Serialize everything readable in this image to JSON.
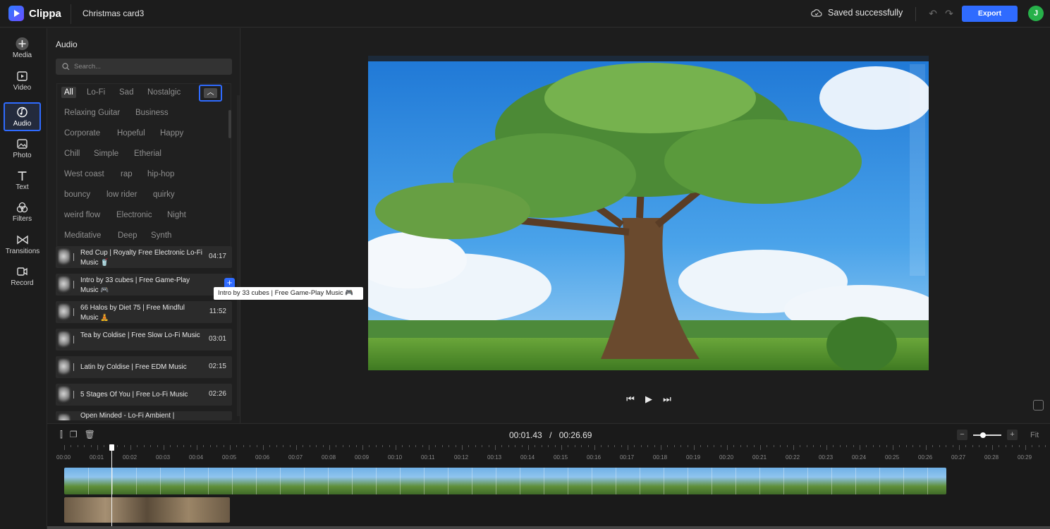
{
  "header": {
    "app_name": "Clippa",
    "project_title": "Christmas card3",
    "save_status": "Saved successfully",
    "export_label": "Export",
    "avatar_initial": "J"
  },
  "rail": [
    {
      "id": "media",
      "label": "Media"
    },
    {
      "id": "video",
      "label": "Video"
    },
    {
      "id": "audio",
      "label": "Audio",
      "active": true
    },
    {
      "id": "photo",
      "label": "Photo"
    },
    {
      "id": "text",
      "label": "Text"
    },
    {
      "id": "filters",
      "label": "Filters"
    },
    {
      "id": "transitions",
      "label": "Transitions"
    },
    {
      "id": "record",
      "label": "Record"
    }
  ],
  "panel": {
    "title": "Audio",
    "search_placeholder": "Search...",
    "tags": [
      [
        "All",
        "Lo-Fi",
        "Sad",
        "Nostalgic"
      ],
      [
        "Relaxing Guitar",
        "Business"
      ],
      [
        "Corporate",
        "Hopeful",
        "Happy"
      ],
      [
        "Chill",
        "Simple",
        "Etherial"
      ],
      [
        "West coast",
        "rap",
        "hip-hop"
      ],
      [
        "bouncy",
        "low rider",
        "quirky"
      ],
      [
        "weird flow",
        "Electronic",
        "Night"
      ],
      [
        "Meditative",
        "Deep",
        "Synth"
      ]
    ],
    "tracks": [
      {
        "title": "Red Cup | Royalty Free Electronic Lo-Fi Music 🥤",
        "duration": "04:17"
      },
      {
        "title": "Intro by 33 cubes | Free Game-Play Music 🎮",
        "duration": "",
        "hovered": true
      },
      {
        "title": "66 Halos by Diet 75 | Free Mindful Music 🧘",
        "duration": "11:52"
      },
      {
        "title": "Tea by Coldise | Free Slow Lo-Fi Music",
        "duration": "03:01"
      },
      {
        "title": "Latin by Coldise | Free EDM Music",
        "duration": "02:15"
      },
      {
        "title": "5 Stages Of You | Free Lo-Fi Music",
        "duration": "02:26"
      },
      {
        "title": "Open Minded - Lo-Fi Ambient |",
        "duration": ""
      }
    ],
    "tooltip": "Intro by 33 cubes | Free Game-Play Music 🎮"
  },
  "timeline": {
    "current_time": "00:01.43",
    "separator": "/",
    "total_time": "00:26.69",
    "fit_label": "Fit",
    "ticks": [
      "00:00",
      "00:01",
      "00:02",
      "00:03",
      "00:04",
      "00:05",
      "00:06",
      "00:07",
      "00:08",
      "00:09",
      "00:10",
      "00:11",
      "00:12",
      "00:13",
      "00:14",
      "00:15",
      "00:16",
      "00:17",
      "00:18",
      "00:19",
      "00:20",
      "00:21",
      "00:22",
      "00:23",
      "00:24",
      "00:25",
      "00:26",
      "00:27",
      "00:28",
      "00:29"
    ]
  },
  "colors": {
    "accent": "#2f6bff",
    "avatar": "#27b14a",
    "background": "#1f1f1f"
  }
}
